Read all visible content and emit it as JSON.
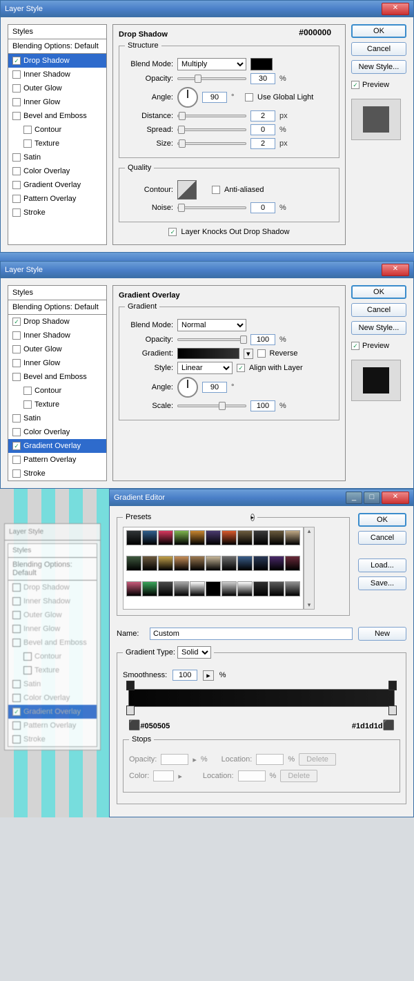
{
  "dialog1": {
    "title": "Layer Style",
    "styles_header": "Styles",
    "blending": "Blending Options: Default",
    "items": [
      {
        "label": "Drop Shadow",
        "checked": true,
        "sel": true
      },
      {
        "label": "Inner Shadow",
        "checked": false
      },
      {
        "label": "Outer Glow",
        "checked": false
      },
      {
        "label": "Inner Glow",
        "checked": false
      },
      {
        "label": "Bevel and Emboss",
        "checked": false
      },
      {
        "label": "Contour",
        "checked": false,
        "indent": true
      },
      {
        "label": "Texture",
        "checked": false,
        "indent": true
      },
      {
        "label": "Satin",
        "checked": false
      },
      {
        "label": "Color Overlay",
        "checked": false
      },
      {
        "label": "Gradient Overlay",
        "checked": false
      },
      {
        "label": "Pattern Overlay",
        "checked": false
      },
      {
        "label": "Stroke",
        "checked": false
      }
    ],
    "section_title": "Drop Shadow",
    "structure": "Structure",
    "blend_mode_label": "Blend Mode:",
    "blend_mode": "Multiply",
    "color_annot": "#000000",
    "opacity_label": "Opacity:",
    "opacity": "30",
    "opacity_unit": "%",
    "angle_label": "Angle:",
    "angle": "90",
    "deg": "°",
    "global_light": "Use Global Light",
    "distance_label": "Distance:",
    "distance": "2",
    "px": "px",
    "spread_label": "Spread:",
    "spread": "0",
    "size_label": "Size:",
    "size": "2",
    "quality": "Quality",
    "contour_label": "Contour:",
    "anti": "Anti-aliased",
    "noise_label": "Noise:",
    "noise": "0",
    "knockout": "Layer Knocks Out Drop Shadow",
    "ok": "OK",
    "cancel": "Cancel",
    "newstyle": "New Style...",
    "preview": "Preview"
  },
  "dialog2": {
    "title": "Layer Style",
    "styles_header": "Styles",
    "blending": "Blending Options: Default",
    "items": [
      {
        "label": "Drop Shadow",
        "checked": true
      },
      {
        "label": "Inner Shadow",
        "checked": false
      },
      {
        "label": "Outer Glow",
        "checked": false
      },
      {
        "label": "Inner Glow",
        "checked": false
      },
      {
        "label": "Bevel and Emboss",
        "checked": false
      },
      {
        "label": "Contour",
        "checked": false,
        "indent": true
      },
      {
        "label": "Texture",
        "checked": false,
        "indent": true
      },
      {
        "label": "Satin",
        "checked": false
      },
      {
        "label": "Color Overlay",
        "checked": false
      },
      {
        "label": "Gradient Overlay",
        "checked": true,
        "sel": true
      },
      {
        "label": "Pattern Overlay",
        "checked": false
      },
      {
        "label": "Stroke",
        "checked": false
      }
    ],
    "section_title": "Gradient Overlay",
    "gradient": "Gradient",
    "blend_mode_label": "Blend Mode:",
    "blend_mode": "Normal",
    "opacity_label": "Opacity:",
    "opacity": "100",
    "pct": "%",
    "gradient_label": "Gradient:",
    "reverse": "Reverse",
    "style_label": "Style:",
    "style": "Linear",
    "align": "Align with Layer",
    "angle_label": "Angle:",
    "angle": "90",
    "deg": "°",
    "scale_label": "Scale:",
    "scale": "100",
    "ok": "OK",
    "cancel": "Cancel",
    "newstyle": "New Style...",
    "preview": "Preview"
  },
  "dialog3_bg": {
    "title": "Layer Style",
    "styles_header": "Styles",
    "blending": "Blending Options: Default",
    "items": [
      "Drop Shadow",
      "Inner Shadow",
      "Outer Glow",
      "Inner Glow",
      "Bevel and Emboss",
      "Contour",
      "Texture",
      "Satin",
      "Color Overlay",
      "Gradient Overlay",
      "Pattern Overlay",
      "Stroke"
    ]
  },
  "gradient_editor": {
    "title": "Gradient Editor",
    "presets": "Presets",
    "ok": "OK",
    "cancel": "Cancel",
    "load": "Load...",
    "save": "Save...",
    "name_label": "Name:",
    "name": "Custom",
    "new": "New",
    "gtype_label": "Gradient Type:",
    "gtype": "Solid",
    "smooth_label": "Smoothness:",
    "smooth": "100",
    "pct": "%",
    "left_hex": "#050505",
    "right_hex": "#1d1d1d",
    "stops": "Stops",
    "opacity_label": "Opacity:",
    "location_label": "Location:",
    "color_label": "Color:",
    "delete": "Delete",
    "preset_colors": [
      "#303436",
      "#2f5e8c",
      "#d6375e",
      "#7eb54e",
      "#c7852f",
      "#4a3a6e",
      "#d85a2c",
      "#6d5d3f",
      "#3a3a3a",
      "#6a5a3c",
      "#bfa884",
      "#3f5a3f",
      "#6e5b3f",
      "#c4a24c",
      "#c8905a",
      "#9e7b52",
      "#c8b89a",
      "#6e6e6e",
      "#3a5e8a",
      "#2a3a58",
      "#4a2a6a",
      "#6a2a3a",
      "#c85a7a",
      "#3aa55a",
      "#4a4a4a",
      "#a8a8a8",
      "#ffffff",
      "#000000",
      "#d0d0d0",
      "#ffffff",
      "#303030",
      "#5a5a5a",
      "#909090"
    ]
  }
}
